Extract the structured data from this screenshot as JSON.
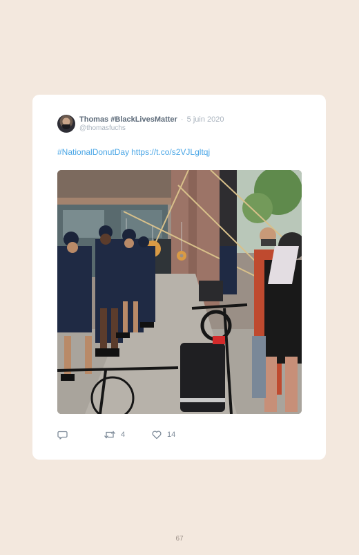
{
  "tweet": {
    "author_name": "Thomas #BlackLivesMatter",
    "separator": "·",
    "date": "5 juin 2020",
    "handle": "@thomasfuchs",
    "hashtag": "#NationalDonutDay",
    "link": "https://t.co/s2VJLgltqj"
  },
  "actions": {
    "reply_icon": "reply-icon",
    "retweet_icon": "retweet-icon",
    "retweet_count": "4",
    "like_icon": "heart-icon",
    "like_count": "14"
  },
  "page": {
    "number": "67"
  },
  "colors": {
    "background": "#f3e8de",
    "card": "#ffffff",
    "link": "#4aa6e6",
    "muted": "#a8b2bd"
  }
}
